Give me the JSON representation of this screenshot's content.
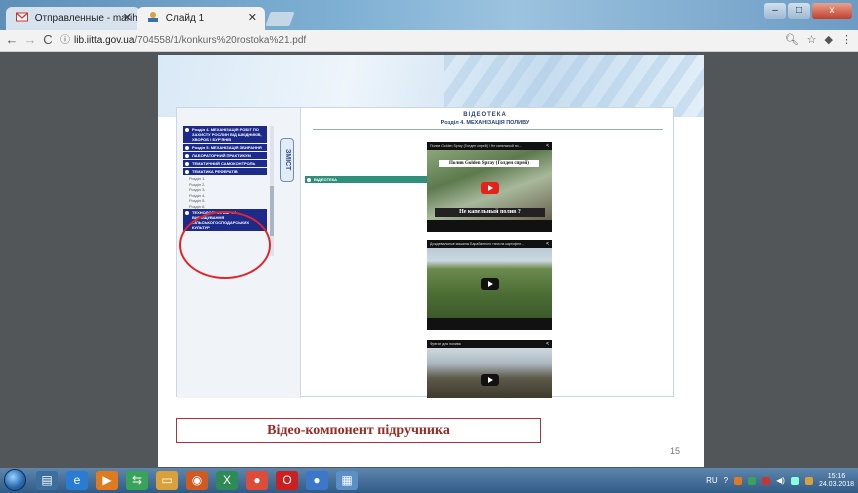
{
  "browser": {
    "tabs": [
      {
        "label": "Отправленные - marih...",
        "icon": "gmail-icon"
      },
      {
        "label": "Слайд 1",
        "icon": "pdf-slide-icon"
      }
    ],
    "window_controls": {
      "minimize": "–",
      "maximize": "□",
      "close": "x"
    },
    "address": {
      "host": "lib.iitta.gov.ua",
      "path": "/704558/1/konkurs%20rostoka%21.pdf"
    }
  },
  "slide": {
    "book": {
      "toc_tab_label": "ЗМІСТ",
      "toc_items": [
        {
          "label": "Розділ 4. МЕХАНІЗАЦІЯ РОБІТ ПО ЗАХИСТУ РОСЛИН ВІД ШКІДНИКІВ, ХВОРОБ І БУР'ЯНІВ",
          "style": "section"
        },
        {
          "label": "Розділ 5. МЕХАНІЗАЦІЯ ЗБИРАННЯ",
          "style": "section"
        },
        {
          "label": "ЛАБОРАТОРНИЙ ПРАКТИКУМ",
          "style": "section"
        },
        {
          "label": "ТЕМАТИЧНИЙ САМОКОНТРОЛЬ",
          "style": "section"
        },
        {
          "label": "ТЕМАТИКА РЕФЕРАТІВ",
          "style": "section"
        },
        {
          "label": "ВІДЕОТЕКА",
          "style": "video"
        }
      ],
      "toc_subitems": [
        "Розділ 1.",
        "Розділ 2.",
        "Розділ 3.",
        "Розділ 4.",
        "Розділ 5.",
        "Розділ 6."
      ],
      "toc_last_item": "ТЕХНОЛОГІЧНІ КАРТИ ВИРОЩУВАННЯ СІЛЬСЬКОГОСПОДАРСЬКИХ КУЛЬТУР",
      "title": "ВІДЕОТЕКА",
      "subtitle": "Розділ 4. МЕХАНІЗАЦІЯ ПОЛИВУ",
      "videos": [
        {
          "title": "Полив Golden Spray (Голден спрей) / Не капельный по...",
          "caption_top": "Полив Golden Spray (Голден спрей)",
          "caption_bottom": "Не капельный полив ?"
        },
        {
          "title": "Дождевальные машины Барабанного типа на картофел...",
          "caption_top": "",
          "caption_bottom": ""
        },
        {
          "title": "Фрегат для полива",
          "caption_top": "",
          "caption_bottom": ""
        }
      ]
    },
    "caption": "Відео-компонент підручника",
    "page_number": "15"
  },
  "taskbar": {
    "apps": [
      "explorer-icon",
      "ie-icon",
      "media-player-icon",
      "vpn-icon",
      "folder-icon",
      "firefox-icon",
      "excel-icon",
      "chrome-icon",
      "opera-icon",
      "chrome-icon-2",
      "pdf-icon"
    ],
    "language": "RU",
    "time": "15:16",
    "date": "24.03.2018"
  },
  "colors": {
    "accent_red": "#e0262a",
    "toc_blue": "#1c2a8a",
    "toc_video": "#2f8f7a",
    "caption_red": "#9b2a24"
  }
}
